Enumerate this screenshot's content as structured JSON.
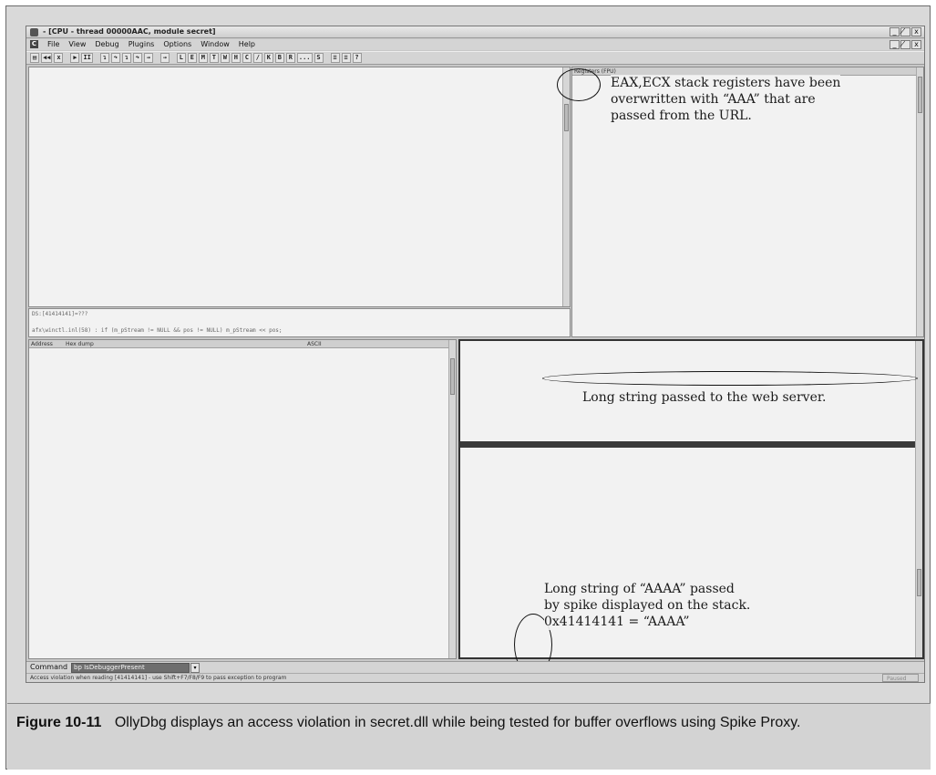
{
  "window": {
    "title": "- [CPU - thread 00000AAC, module secret]",
    "controls_top": [
      "_",
      "̸",
      "x"
    ],
    "controls_menu": [
      "_",
      "̸",
      "x"
    ]
  },
  "menu": {
    "app_letter": "C",
    "items": [
      "File",
      "View",
      "Debug",
      "Plugins",
      "Options",
      "Window",
      "Help"
    ]
  },
  "toolbar": {
    "buttons": [
      "▤",
      "◀◀",
      "x",
      "▶",
      "II",
      "↴",
      "↷",
      "↴",
      "↷",
      "→",
      "→",
      "L",
      "E",
      "M",
      "T",
      "W",
      "H",
      "C",
      "/",
      "K",
      "B",
      "R",
      "...",
      "S",
      "≡",
      "≡",
      "?"
    ]
  },
  "panes": {
    "registers_header": "Registers (FPU)",
    "dump_header_address": "Address",
    "dump_header_hex": "Hex dump",
    "dump_header_ascii": "ASCII",
    "info_line1": "DS:[41414141]=???",
    "info_line2": "afx\\winctl.inl(58) : if (m_pStream != NULL && pos != NULL) m_pStream << pos;"
  },
  "annotations": {
    "registers_note": [
      "EAX,ECX stack registers have been",
      "overwritten with “AAA” that are",
      "passed from the URL."
    ],
    "long_string_note": "Long string passed to the web server.",
    "stack_note": [
      "Long string of “AAAA” passed",
      "by spike displayed on the stack.",
      "0x41414141 = “AAAA”"
    ]
  },
  "command": {
    "label": "Command",
    "value": "bp IsDebuggerPresent",
    "dropdown": "▾"
  },
  "status": {
    "message": "Access violation when reading [41414141] - use Shift+F7/F8/F9 to pass exception to program",
    "state": "Paused"
  },
  "caption": {
    "label": "Figure 10-11",
    "text": "OllyDbg displays an access violation in secret.dll while being tested for buffer overflows using Spike Proxy."
  }
}
